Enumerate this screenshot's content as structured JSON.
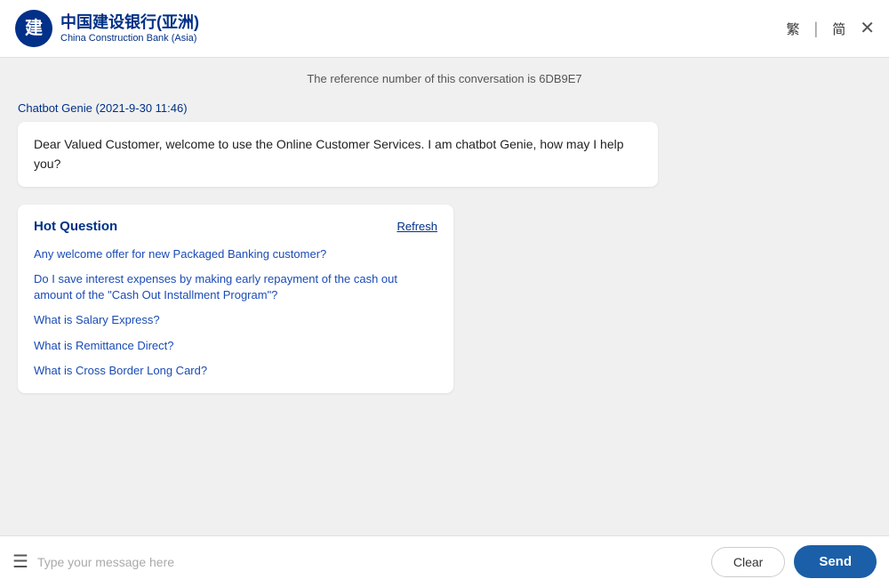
{
  "header": {
    "logo_cn": "中国建设银行(亚洲)",
    "logo_en": "China Construction Bank (Asia)",
    "lang_traditional": "繁",
    "lang_simplified": "简",
    "close_label": "✕"
  },
  "chat": {
    "reference_text": "The reference number of this conversation is 6DB9E7",
    "sender_label": "Chatbot Genie (2021-9-30 11:46)",
    "welcome_message": "Dear Valued Customer, welcome to use the Online Customer Services. I am chatbot Genie, how may I help you?",
    "hot_question": {
      "title": "Hot Question",
      "refresh_label": "Refresh",
      "questions": [
        "Any welcome offer for new Packaged Banking customer?",
        "Do I save interest expenses by making early repayment of the cash out amount of the \"Cash Out Installment Program\"?",
        "What is Salary Express?",
        "What is Remittance Direct?",
        "What is Cross Border Long Card?"
      ]
    }
  },
  "input_area": {
    "placeholder": "Type your message here",
    "clear_label": "Clear",
    "send_label": "Send",
    "menu_icon": "☰"
  }
}
